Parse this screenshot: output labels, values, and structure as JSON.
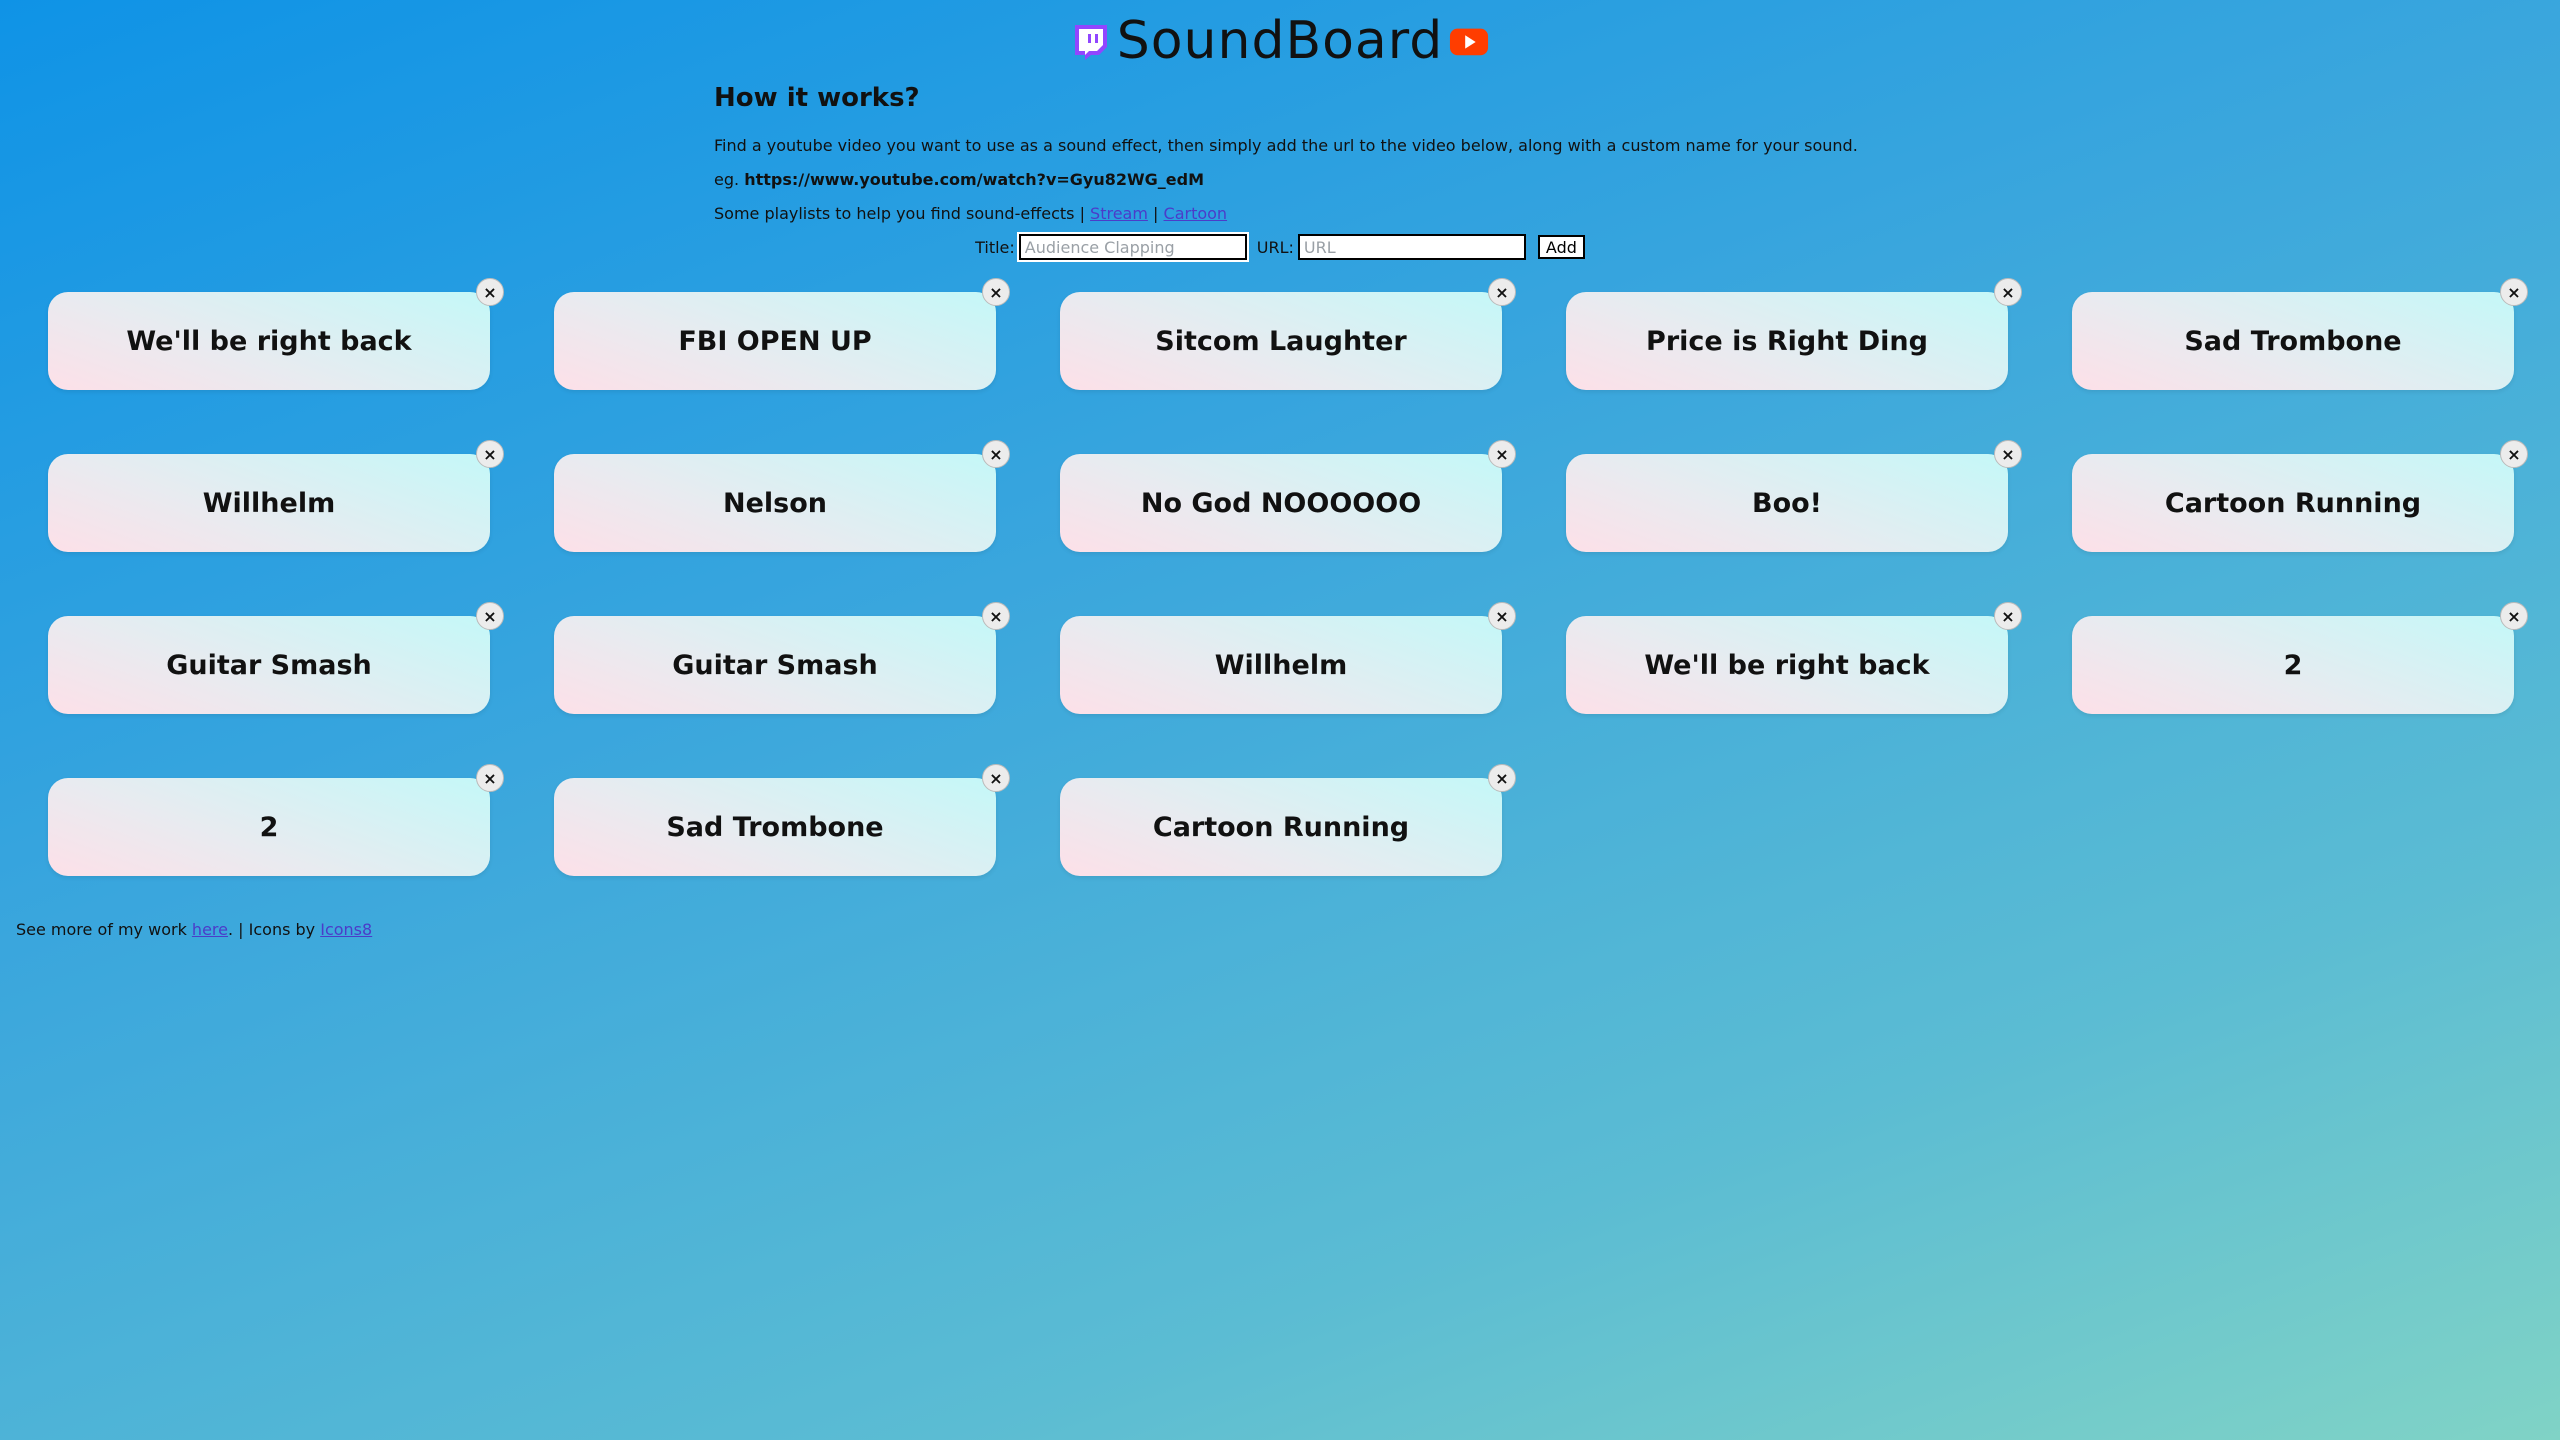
{
  "header": {
    "title": "SoundBoard",
    "left_icon": "twitch-icon",
    "right_icon": "youtube-icon",
    "twitch_color": "#9146FF",
    "youtube_color": "#FF3D00"
  },
  "info": {
    "heading": "How it works?",
    "description": "Find a youtube video you want to use as a sound effect, then simply add the url to the video below, along with a custom name for your sound.",
    "example_prefix": "eg.",
    "example_url": "https://www.youtube.com/watch?v=Gyu82WG_edM",
    "playlists_text": "Some playlists to help you find sound-effects |",
    "playlist_stream": "Stream",
    "playlist_separator": "|",
    "playlist_cartoon": "Cartoon"
  },
  "form": {
    "title_label": "Title:",
    "title_placeholder": "Audience Clapping",
    "title_value": "",
    "url_label": "URL:",
    "url_placeholder": "URL",
    "url_value": "",
    "add_label": "Add"
  },
  "sounds": [
    "We'll be right back",
    "FBI OPEN UP",
    "Sitcom Laughter",
    "Price is Right Ding",
    "Sad Trombone",
    "Willhelm",
    "Nelson",
    "No God NOOOOOO",
    "Boo!",
    "Cartoon Running",
    "Guitar Smash",
    "Guitar Smash",
    "Willhelm",
    "We'll be right back",
    "2",
    "2",
    "Sad Trombone",
    "Cartoon Running"
  ],
  "close_glyph": "×",
  "footer": {
    "prefix": "See more of my work",
    "here_link": "here",
    "middle": ". | Icons by",
    "icons8_link": "Icons8"
  }
}
